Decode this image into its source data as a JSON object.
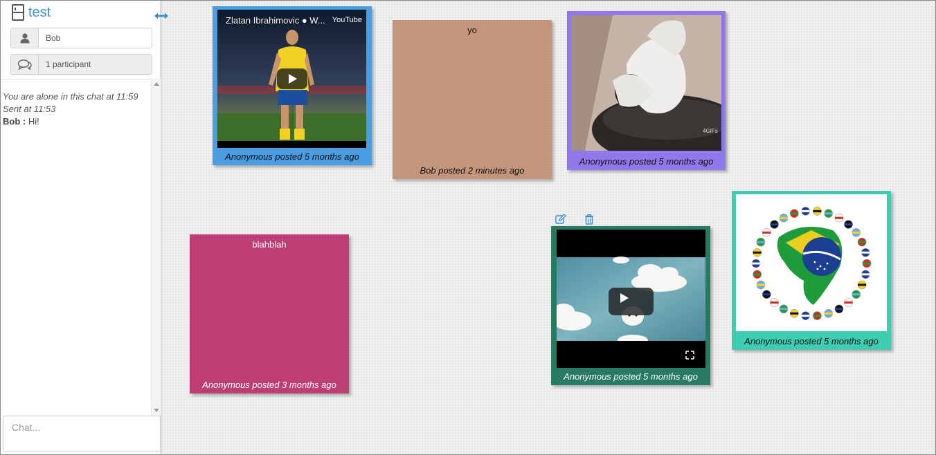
{
  "sidebar": {
    "title": "test",
    "username": "Bob",
    "participants": "1 participant",
    "chat_messages": [
      {
        "type": "system",
        "text": "You are alone in this chat at 11:59"
      },
      {
        "type": "system",
        "text": "Sent at 11:53"
      },
      {
        "type": "message",
        "author": "Bob :",
        "text": "Hi!"
      }
    ],
    "chat_placeholder": "Chat..."
  },
  "postits": [
    {
      "id": "zlatan-video",
      "kind": "video",
      "video_title": "Zlatan Ibrahimovic ● W...",
      "provider": "YouTube",
      "caption": "Anonymous posted 5 months ago",
      "color": "#4a9de0"
    },
    {
      "id": "yo-note",
      "kind": "text",
      "text": "yo",
      "caption": "Bob posted 2 minutes ago",
      "color": "#c4957a"
    },
    {
      "id": "cats-image",
      "kind": "image",
      "caption": "Anonymous posted 5 months ago",
      "color": "#8e78ea"
    },
    {
      "id": "brazil-image",
      "kind": "image",
      "caption": "Anonymous posted 5 months ago",
      "color": "#3ecdb0"
    },
    {
      "id": "blahblah-note",
      "kind": "text",
      "text": "blahblah",
      "caption": "Anonymous posted 3 months ago",
      "color": "#bd3e75"
    },
    {
      "id": "clouds-video",
      "kind": "video",
      "caption": "Anonymous posted 5 months ago",
      "color": "#277a63"
    }
  ],
  "toolbar_icons": [
    "edit-icon",
    "trash-icon"
  ],
  "colors": {
    "accent": "#3b8fd0"
  }
}
